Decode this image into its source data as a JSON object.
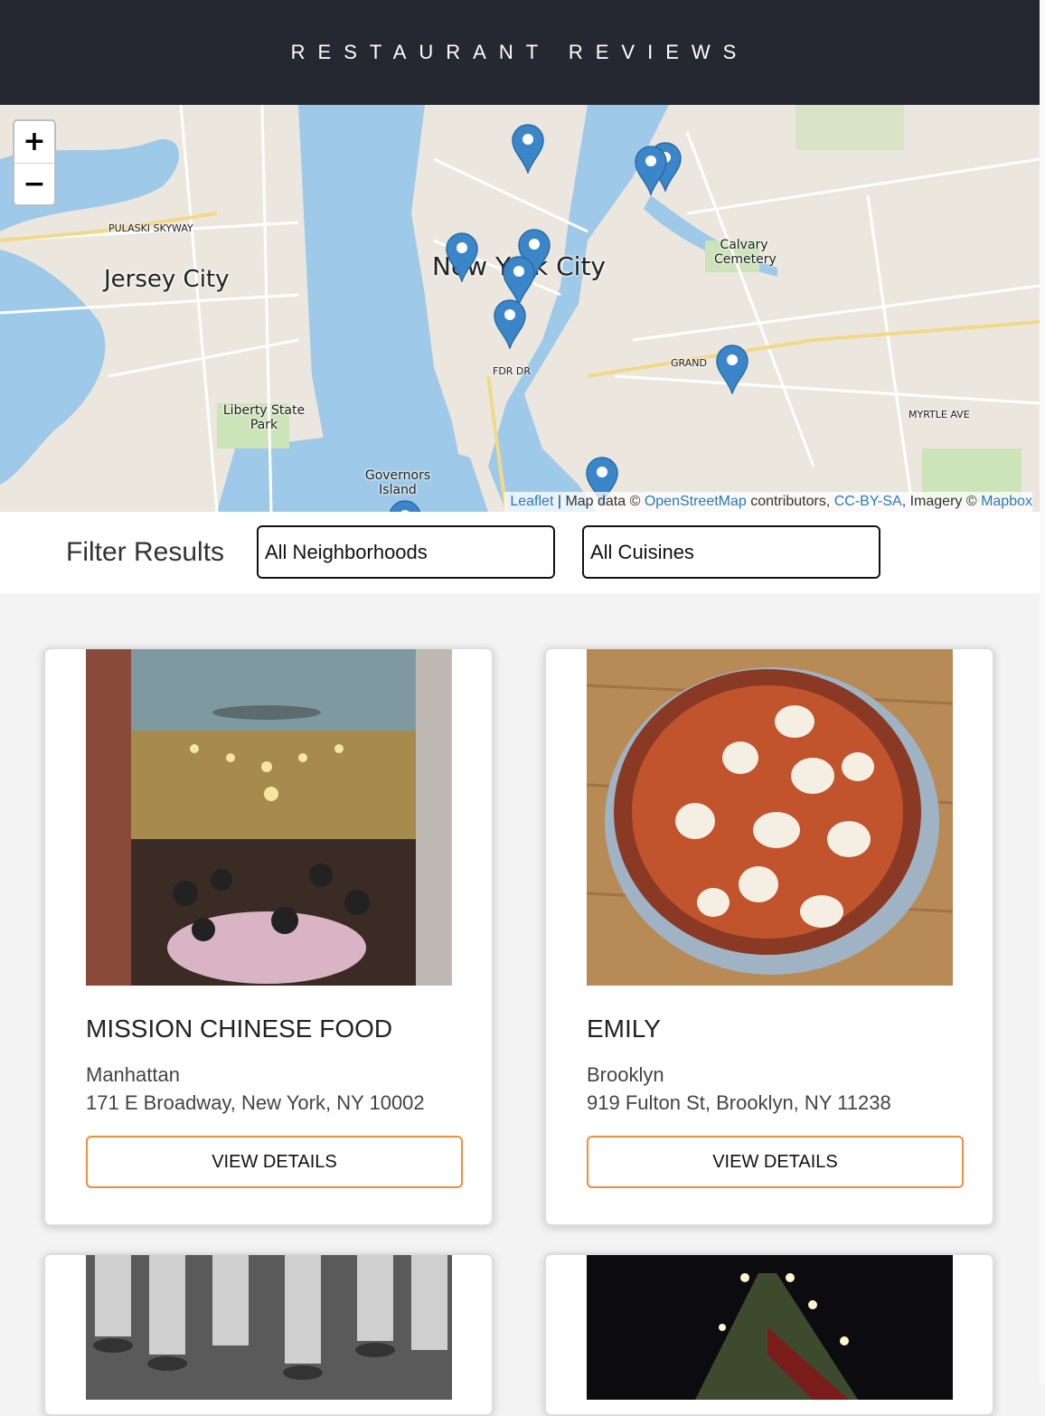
{
  "header": {
    "title": "RESTAURANT REVIEWS"
  },
  "map": {
    "zoom_in": "+",
    "zoom_out": "−",
    "labels": {
      "jersey_city": "Jersey City",
      "new_york_city": "New York City",
      "liberty_state_park": "Liberty State Park",
      "governors_island": "Governors Island",
      "calvary_cemetery": "Calvary Cemetery",
      "pulaski_skyway": "PULASKI SKYWAY",
      "grand": "GRAND",
      "fdr_dr": "FDR DR",
      "myrtle_ave": "MYRTLE AVE"
    },
    "attribution": {
      "leaflet": "Leaflet",
      "map_data": " | Map data © ",
      "osm": "OpenStreetMap",
      "contributors": " contributors, ",
      "license": "CC-BY-SA",
      "imagery": ", Imagery © ",
      "mapbox": "Mapbox"
    },
    "colors": {
      "water": "#9fc9e8",
      "land": "#ebe7df",
      "park": "#cde3b8",
      "marker": "#3a86c8"
    }
  },
  "filter": {
    "label": "Filter Results",
    "neighborhood_selected": "All Neighborhoods",
    "cuisine_selected": "All Cuisines"
  },
  "restaurants": [
    {
      "name": "Mission Chinese Food",
      "neighborhood": "Manhattan",
      "address": "171 E Broadway, New York, NY 10002",
      "button": "View Details",
      "photo": "restaurant-interior-photo"
    },
    {
      "name": "Emily",
      "neighborhood": "Brooklyn",
      "address": "919 Fulton St, Brooklyn, NY 11238",
      "button": "View Details",
      "photo": "pizza-photo"
    }
  ],
  "accent_color": "#f08c3c"
}
